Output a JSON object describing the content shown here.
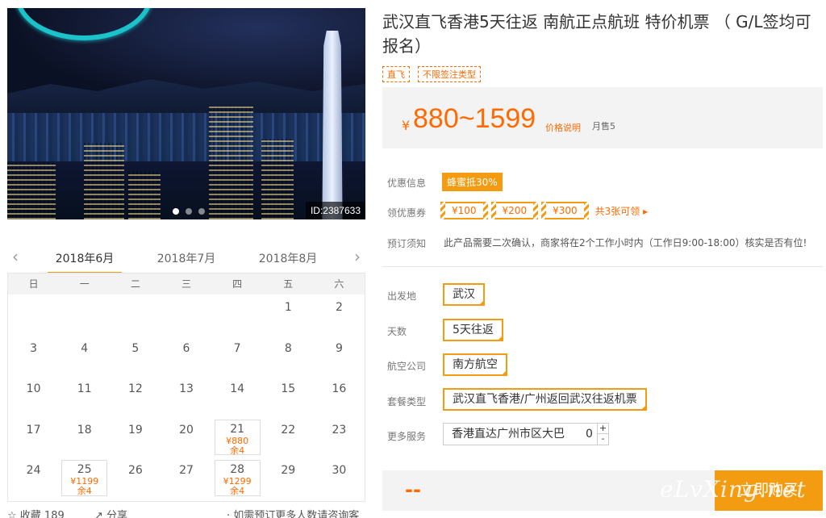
{
  "gallery": {
    "image_id": "ID:2387633",
    "slide_count": 3,
    "active_slide": 1
  },
  "calendar": {
    "prev_arrow": "‹",
    "next_arrow": "›",
    "months": [
      "2018年6月",
      "2018年7月",
      "2018年8月"
    ],
    "active_month": 0,
    "weekdays": [
      "日",
      "一",
      "二",
      "三",
      "四",
      "五",
      "六"
    ],
    "weeks": [
      [
        {
          "d": ""
        },
        {
          "d": ""
        },
        {
          "d": ""
        },
        {
          "d": ""
        },
        {
          "d": ""
        },
        {
          "d": "1"
        },
        {
          "d": "2"
        }
      ],
      [
        {
          "d": "3"
        },
        {
          "d": "4"
        },
        {
          "d": "5"
        },
        {
          "d": "6"
        },
        {
          "d": "7"
        },
        {
          "d": "8"
        },
        {
          "d": "9"
        }
      ],
      [
        {
          "d": "10"
        },
        {
          "d": "11"
        },
        {
          "d": "12"
        },
        {
          "d": "13"
        },
        {
          "d": "14"
        },
        {
          "d": "15"
        },
        {
          "d": "16"
        }
      ],
      [
        {
          "d": "17"
        },
        {
          "d": "18"
        },
        {
          "d": "19"
        },
        {
          "d": "20"
        },
        {
          "d": "21",
          "price": "¥880",
          "left": "余4"
        },
        {
          "d": "22"
        },
        {
          "d": "23"
        }
      ],
      [
        {
          "d": "24"
        },
        {
          "d": "25",
          "price": "¥1199",
          "left": "余4"
        },
        {
          "d": "26"
        },
        {
          "d": "27"
        },
        {
          "d": "28",
          "price": "¥1299",
          "left": "余4"
        },
        {
          "d": "29"
        },
        {
          "d": "30"
        }
      ]
    ]
  },
  "footer": {
    "favorite_label": "☆ 收藏 189",
    "share_label": "↗ 分享",
    "consult_text": "· 如需预订更多人数请咨询客服"
  },
  "product": {
    "title": "武汉直飞香港5天往返 南航正点航班 特价机票 （ G/L签均可报名）",
    "tags": [
      "直飞",
      "不限签注类型"
    ],
    "price": {
      "currency": "¥",
      "range": "880~1599",
      "note": "价格说明",
      "sold": "月售5"
    },
    "promo_label": "优惠信息",
    "promo_badge": "蜂蜜抵30%",
    "coupon_label": "领优惠券",
    "coupons": [
      "¥100",
      "¥200",
      "¥300"
    ],
    "coupon_more": "共3张可领 ▸",
    "notice_label": "预订须知",
    "notice_text": "此产品需要二次确认，商家将在2个工作小时内（工作日9:00-18:00）核实是否有位!",
    "options": {
      "departure_label": "出发地",
      "departure_value": "武汉",
      "days_label": "天数",
      "days_value": "5天往返",
      "airline_label": "航空公司",
      "airline_value": "南方航空",
      "package_label": "套餐类型",
      "package_value": "武汉直飞香港/广州返回武汉往返机票",
      "service_label": "更多服务",
      "service_value": "香港直达广州市区大巴",
      "service_qty": "0",
      "plus": "+",
      "minus": "-"
    },
    "total": "--",
    "buy_label": "立即购买",
    "watermark": "eLvXing.net"
  },
  "colors": {
    "accent": "#f39c12",
    "price": "#ff6a00"
  }
}
